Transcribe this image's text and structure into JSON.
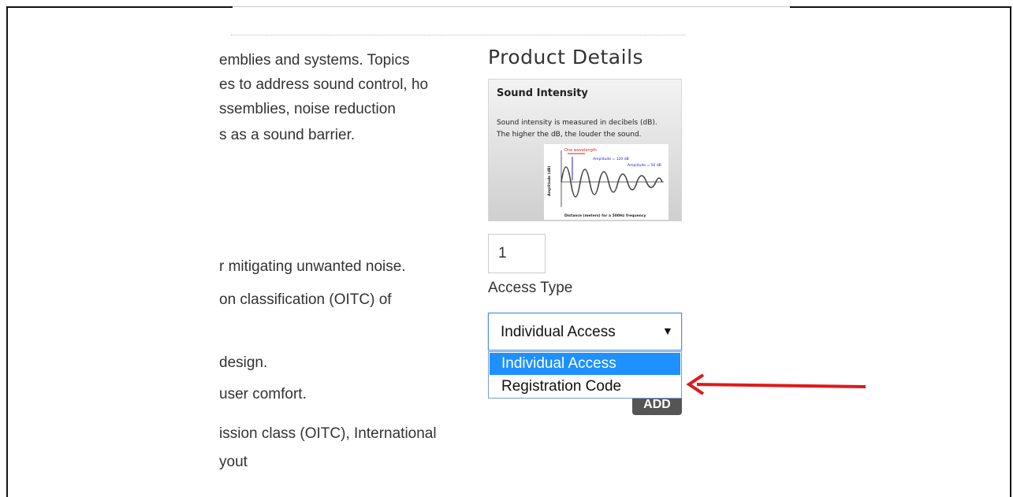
{
  "description_lines_top": [
    "emblies and systems. Topics",
    "es to address sound control, ho",
    "ssemblies, noise reduction",
    "s as a sound barrier."
  ],
  "description_lines_bottom": [
    "r mitigating unwanted noise.",
    "on classification (OITC) of",
    "design.",
    "user comfort.",
    "ission class (OITC), International",
    "yout"
  ],
  "product": {
    "title": "Product Details",
    "thumbnail": {
      "title": "Sound Intensity",
      "body_line1": "Sound intensity is measured in decibels (dB).",
      "body_line2": "The higher the dB, the louder the sound.",
      "graph_xlabel": "Distance (meters) for a 500Hz frequency",
      "graph_ylabel": "Amplitude (dB)",
      "graph_note1": "One wavelength",
      "graph_note2": "Amplitude = 120 dB",
      "graph_note3": "Amplitude = 50 dB"
    },
    "quantity": "1",
    "access_type_label": "Access Type",
    "access_type_selected": "Individual Access",
    "access_type_options": [
      "Individual Access",
      "Registration Code"
    ],
    "add_label": "ADD"
  },
  "colors": {
    "highlight": "#1e90ff",
    "arrow": "#e0191b",
    "button": "#555555"
  }
}
